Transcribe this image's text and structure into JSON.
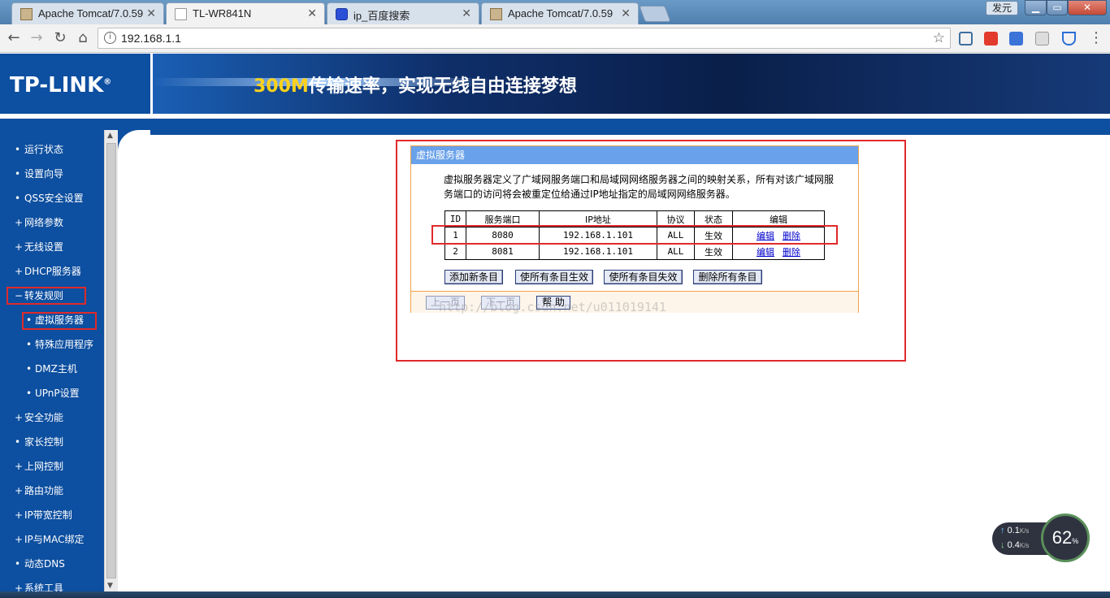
{
  "browser": {
    "tabs": [
      {
        "label": "Apache Tomcat/7.0.59",
        "icon": "tomcat-icon"
      },
      {
        "label": "TL-WR841N",
        "icon": "page-icon"
      },
      {
        "label": "ip_百度搜索",
        "icon": "baidu-paw-icon"
      },
      {
        "label": "Apache Tomcat/7.0.59",
        "icon": "tomcat-icon"
      }
    ],
    "user": "发元",
    "url": "192.168.1.1"
  },
  "header": {
    "logo": "TP-LINK",
    "slogan_prefix": "300M",
    "slogan_rest": "传输速率，实现无线自由连接梦想"
  },
  "sidebar": {
    "items": [
      {
        "mark": "•",
        "label": "运行状态"
      },
      {
        "mark": "•",
        "label": "设置向导"
      },
      {
        "mark": "•",
        "label": "QSS安全设置"
      },
      {
        "mark": "+",
        "label": "网络参数"
      },
      {
        "mark": "+",
        "label": "无线设置"
      },
      {
        "mark": "+",
        "label": "DHCP服务器"
      },
      {
        "mark": "−",
        "label": "转发规则"
      },
      {
        "mark": "•",
        "label": "虚拟服务器"
      },
      {
        "mark": "•",
        "label": "特殊应用程序"
      },
      {
        "mark": "•",
        "label": "DMZ主机"
      },
      {
        "mark": "•",
        "label": "UPnP设置"
      },
      {
        "mark": "+",
        "label": "安全功能"
      },
      {
        "mark": "•",
        "label": "家长控制"
      },
      {
        "mark": "+",
        "label": "上网控制"
      },
      {
        "mark": "+",
        "label": "路由功能"
      },
      {
        "mark": "+",
        "label": "IP带宽控制"
      },
      {
        "mark": "+",
        "label": "IP与MAC绑定"
      },
      {
        "mark": "•",
        "label": "动态DNS"
      },
      {
        "mark": "+",
        "label": "系统工具"
      }
    ]
  },
  "panel": {
    "title": "虚拟服务器",
    "description": "虚拟服务器定义了广域网服务端口和局域网网络服务器之间的映射关系，所有对该广域网服务端口的访问将会被重定位给通过IP地址指定的局域网网络服务器。",
    "table": {
      "headers": [
        "ID",
        "服务端口",
        "IP地址",
        "协议",
        "状态",
        "编辑"
      ],
      "rows": [
        {
          "id": "1",
          "port": "8080",
          "ip": "192.168.1.101",
          "protocol": "ALL",
          "status": "生效",
          "edit": "编辑",
          "delete": "删除"
        },
        {
          "id": "2",
          "port": "8081",
          "ip": "192.168.1.101",
          "protocol": "ALL",
          "status": "生效",
          "edit": "编辑",
          "delete": "删除"
        }
      ]
    },
    "buttons": {
      "add": "添加新条目",
      "enable_all": "使所有条目生效",
      "disable_all": "使所有条目失效",
      "delete_all": "删除所有条目"
    },
    "pager": {
      "prev": "上一页",
      "next": "下一页",
      "help": "帮 助"
    },
    "watermark": "http://blog.csdn.net/u011019141"
  },
  "speed_widget": {
    "up": "0.1",
    "down": "0.4",
    "unit": "K/s",
    "percent": "62",
    "percent_sign": "%"
  },
  "colors": {
    "brand_blue": "#0d4fa0",
    "highlight_red": "#e02a2a",
    "panel_title": "#69a1ea",
    "panel_border": "#f0a34c"
  }
}
